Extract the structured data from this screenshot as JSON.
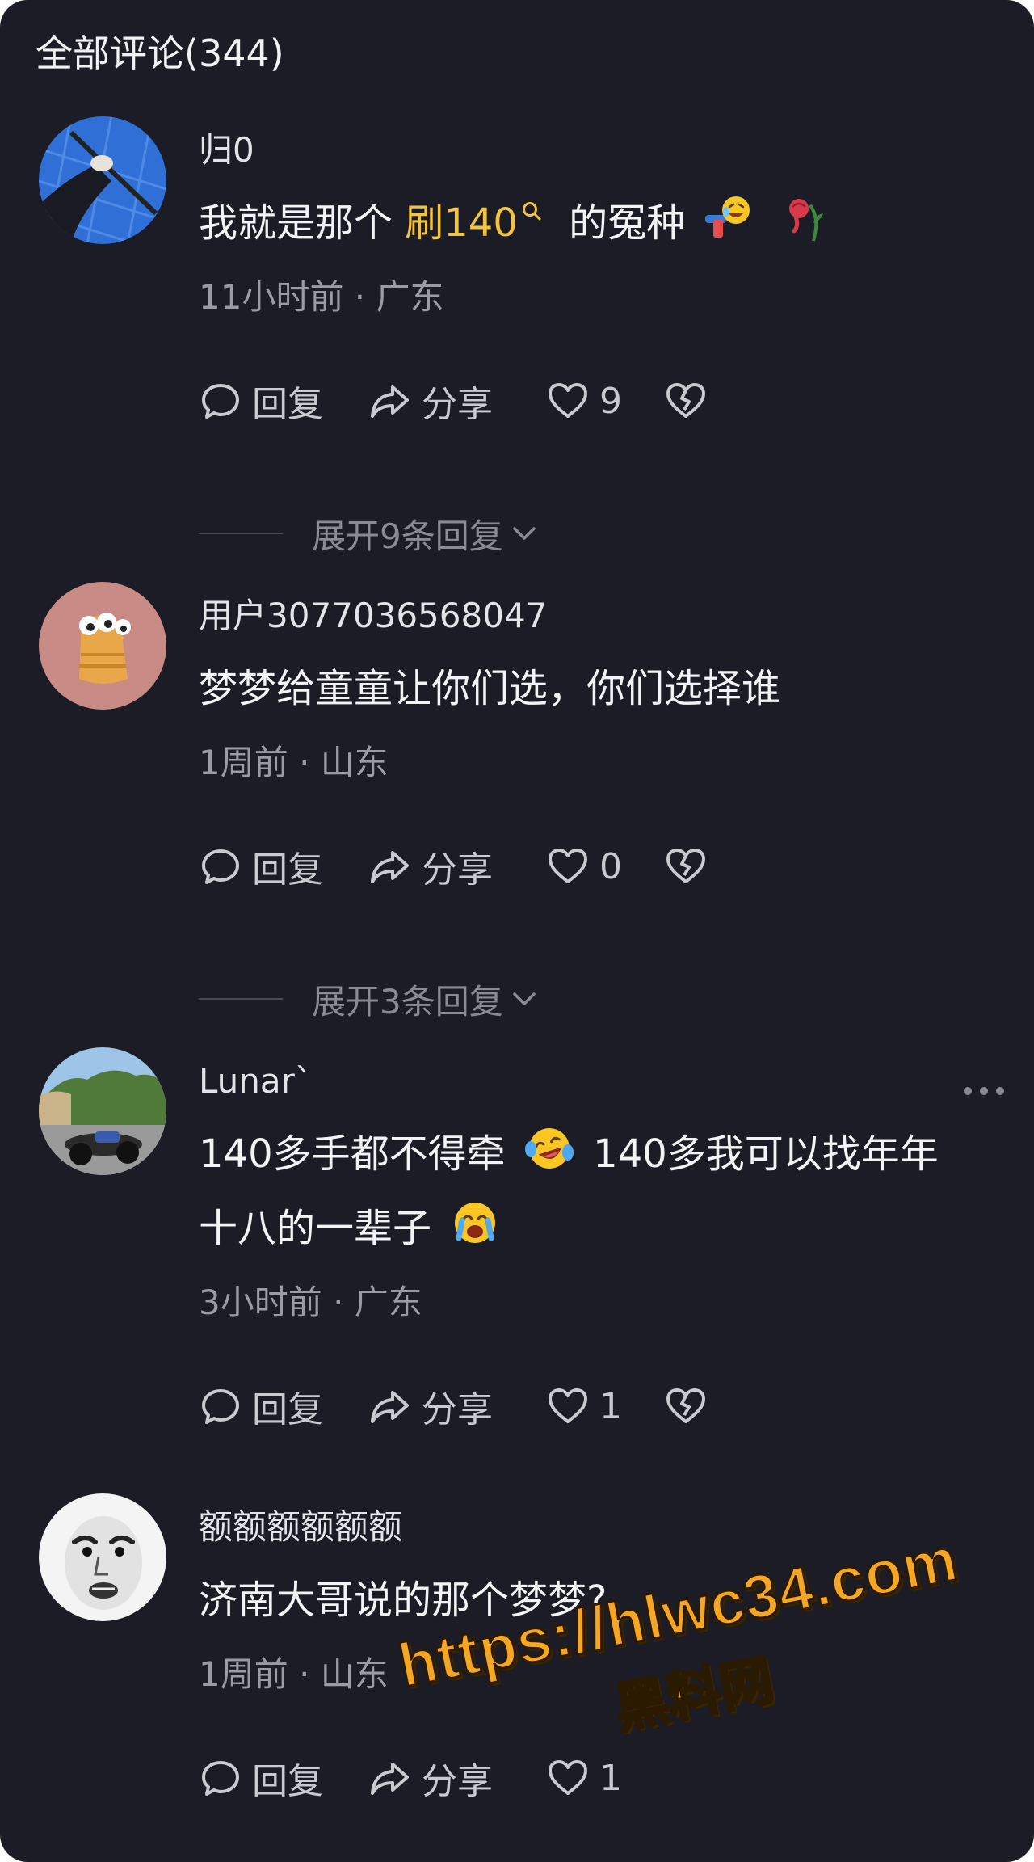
{
  "header": {
    "title": "全部评论(344)"
  },
  "labels": {
    "reply": "回复",
    "share": "分享"
  },
  "comments": [
    {
      "user": "归0",
      "text_before": "我就是那个 ",
      "search_term": "刷140",
      "text_after": " 的冤种",
      "emojis": [
        "laughing-crying-emoji",
        "wilted-rose-emoji"
      ],
      "meta": "11小时前 · 广东",
      "likes": "9",
      "expand": "展开9条回复"
    },
    {
      "user": "用户3077036568047",
      "text": "梦梦给童童让你们选，你们选择谁",
      "meta": "1周前 · 山东",
      "likes": "0",
      "expand": "展开3条回复"
    },
    {
      "user": "Lunar`",
      "text_line1a": "140多手都不得牵",
      "text_line1b": "140多我可以找年年",
      "text_line2": "十八的一辈子",
      "emojis": [
        "tears-of-joy-emoji",
        "crying-emoji"
      ],
      "meta": "3小时前 · 广东",
      "likes": "1"
    },
    {
      "user": "额额额额额额",
      "text": "济南大哥说的那个梦梦?",
      "meta": "1周前 · 山东",
      "likes": "1"
    }
  ],
  "watermark": {
    "line1": "https://hlwc34.com",
    "line2": "黑料网"
  },
  "colors": {
    "background": "#1c1c26",
    "highlight": "#f2c43f",
    "watermark": "#f5a623"
  }
}
